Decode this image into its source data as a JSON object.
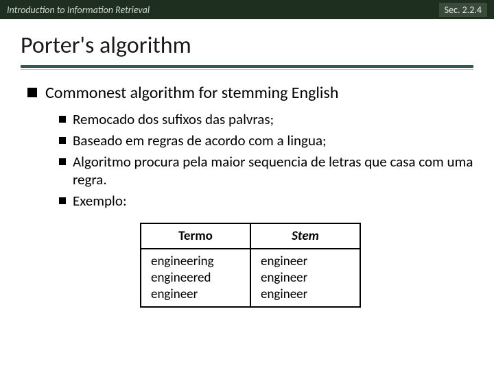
{
  "topbar": {
    "left": "Introduction to Information Retrieval",
    "right": "Sec. 2.2.4"
  },
  "title": "Porter's algorithm",
  "bullets": {
    "l1": "Commonest algorithm for stemming English",
    "subs": [
      "Remocado dos sufixos das palvras;",
      "Baseado em regras de acordo com a lingua;",
      "Algoritmo procura pela maior sequencia de letras que casa com uma regra.",
      "Exemplo:"
    ]
  },
  "table": {
    "header": {
      "col1": "Termo",
      "col2": "Stem"
    },
    "col1": "engineering\nengineered\nengineer",
    "col2": "engineer\nengineer\nengineer"
  }
}
